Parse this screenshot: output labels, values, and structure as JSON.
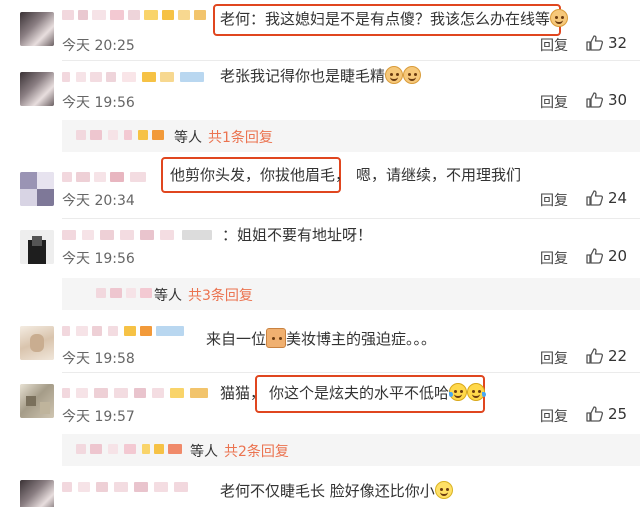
{
  "comments": [
    {
      "text": "老何：我这媳妇是不是有点傻？我该怎么办在线等",
      "time": "今天 20:25",
      "reply_label": "回复",
      "likes": "32",
      "emoji": "cat-face-icon",
      "highlighted": true
    },
    {
      "text": "老张我记得你也是睫毛精",
      "time": "今天 19:56",
      "reply_label": "回复",
      "likes": "30",
      "emoji": "cat-face-icon",
      "sub_replies": {
        "who": "等人",
        "count_label": "共1条回复"
      }
    },
    {
      "text_highlighted": "他剪你头发，你拔他眉毛，",
      "text": "嗯，请继续，不用理我们",
      "time": "今天 20:34",
      "reply_label": "回复",
      "likes": "24",
      "highlighted": true
    },
    {
      "text": "：姐姐不要有地址呀！",
      "time": "今天 19:56",
      "reply_label": "回复",
      "likes": "20",
      "sub_replies": {
        "who": "等人",
        "count_label": "共3条回复"
      }
    },
    {
      "text_prefix": "来自一位",
      "text": "美妆博主的强迫症。。。",
      "time": "今天 19:58",
      "reply_label": "回复",
      "likes": "22"
    },
    {
      "text_prefix": "猫猫，",
      "text_highlighted": "你这个是炫夫的水平不低哈",
      "time": "今天 19:57",
      "reply_label": "回复",
      "likes": "25",
      "emoji": "laughing-tears-icon",
      "highlighted": true,
      "sub_replies": {
        "who": "等人",
        "count_label": "共2条回复"
      }
    },
    {
      "text": "老何不仅睫毛长 脸好像还比你小",
      "emoji": "smile-face-icon"
    }
  ],
  "colors": {
    "highlight_border": "#e0461f",
    "reply_count": "#eb7350",
    "sub_reply_bg": "#f5f5f5"
  }
}
